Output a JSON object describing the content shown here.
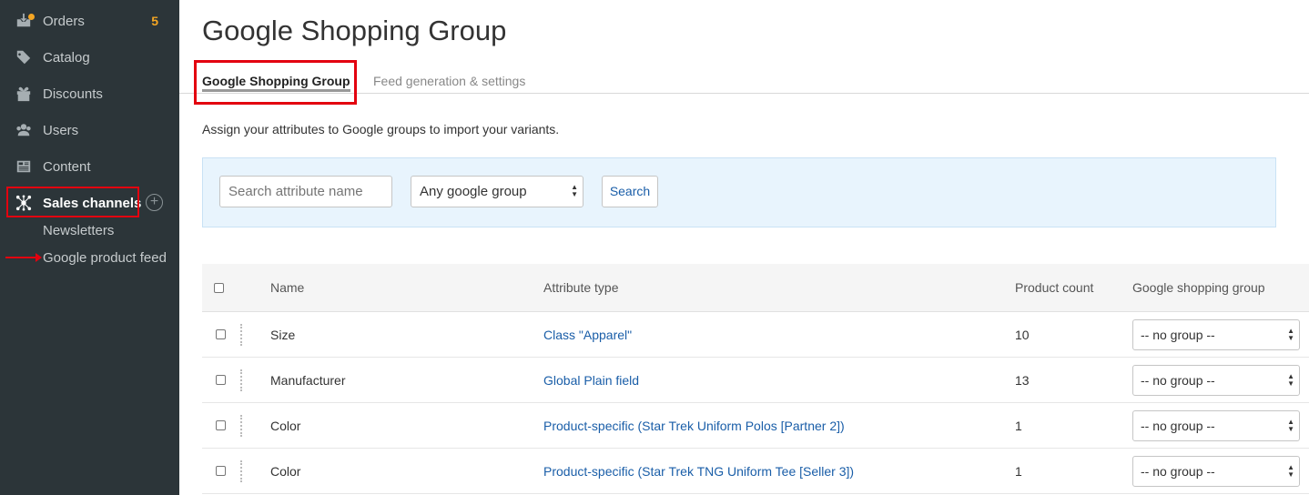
{
  "sidebar": {
    "items": [
      {
        "name": "orders",
        "label": "Orders",
        "count": "5",
        "icon": "orders-icon"
      },
      {
        "name": "catalog",
        "label": "Catalog",
        "icon": "tag-icon"
      },
      {
        "name": "discounts",
        "label": "Discounts",
        "icon": "gift-icon"
      },
      {
        "name": "users",
        "label": "Users",
        "icon": "users-icon"
      },
      {
        "name": "content",
        "label": "Content",
        "icon": "newspaper-icon"
      },
      {
        "name": "sales-channels",
        "label": "Sales channels",
        "icon": "network-icon"
      }
    ],
    "sub_items": [
      {
        "label": "Newsletters"
      },
      {
        "label": "Google product feed"
      }
    ],
    "plus_label": "+"
  },
  "main": {
    "title": "Google Shopping Group",
    "tabs": [
      {
        "label": "Google Shopping Group"
      },
      {
        "label": "Feed generation & settings"
      }
    ],
    "intro": "Assign your attributes to Google groups to import your variants.",
    "search": {
      "placeholder": "Search attribute name",
      "group_select": "Any google group",
      "button": "Search"
    },
    "table": {
      "headers": {
        "name": "Name",
        "attribute_type": "Attribute type",
        "product_count": "Product count",
        "google_group": "Google shopping group"
      },
      "rows": [
        {
          "name": "Size",
          "type": "Class \"Apparel\"",
          "count": "10",
          "group": "-- no group --"
        },
        {
          "name": "Manufacturer",
          "type": "Global Plain field",
          "count": "13",
          "group": "-- no group --"
        },
        {
          "name": "Color",
          "type": "Product-specific (Star Trek Uniform Polos [Partner 2])",
          "count": "1",
          "group": "-- no group --"
        },
        {
          "name": "Color",
          "type": "Product-specific (Star Trek TNG Uniform Tee [Seller 3])",
          "count": "1",
          "group": "-- no group --"
        }
      ]
    }
  },
  "colors": {
    "sidebar_bg": "#2c3539",
    "accent_red": "#e3000f",
    "link_blue": "#1a5ea8",
    "badge_orange": "#f5a623",
    "search_panel_bg": "#e8f4fd"
  }
}
